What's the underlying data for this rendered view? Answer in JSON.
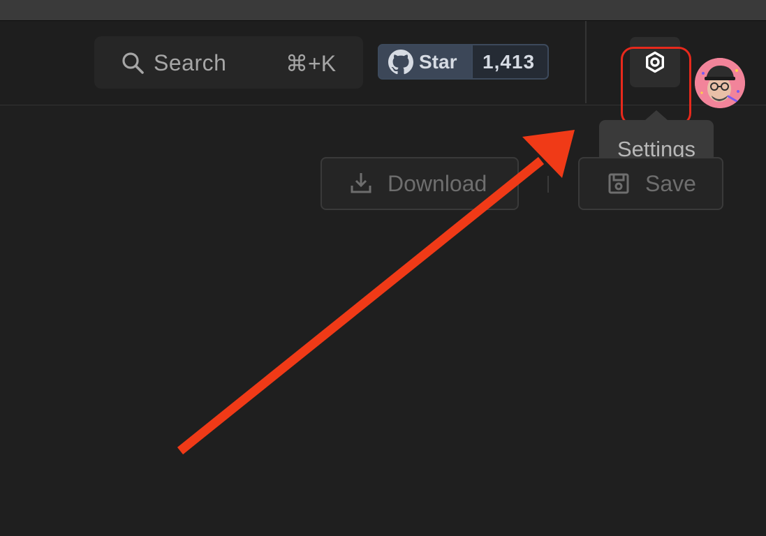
{
  "header": {
    "search": {
      "label": "Search",
      "shortcut": "⌘+K",
      "icon": "search-icon"
    },
    "github": {
      "star_label": "Star",
      "star_count": "1,413",
      "icon": "github-icon"
    },
    "settings": {
      "icon": "gear-icon",
      "tooltip": "Settings"
    },
    "avatar": {
      "icon": "user-avatar"
    }
  },
  "toolbar": {
    "download_label": "Download",
    "download_icon": "download-icon",
    "save_label": "Save",
    "save_icon": "save-icon"
  },
  "colors": {
    "background": "#1f1f1f",
    "annotation": "#f03a17",
    "highlight": "#e8291c",
    "badge": "#3c4758"
  }
}
